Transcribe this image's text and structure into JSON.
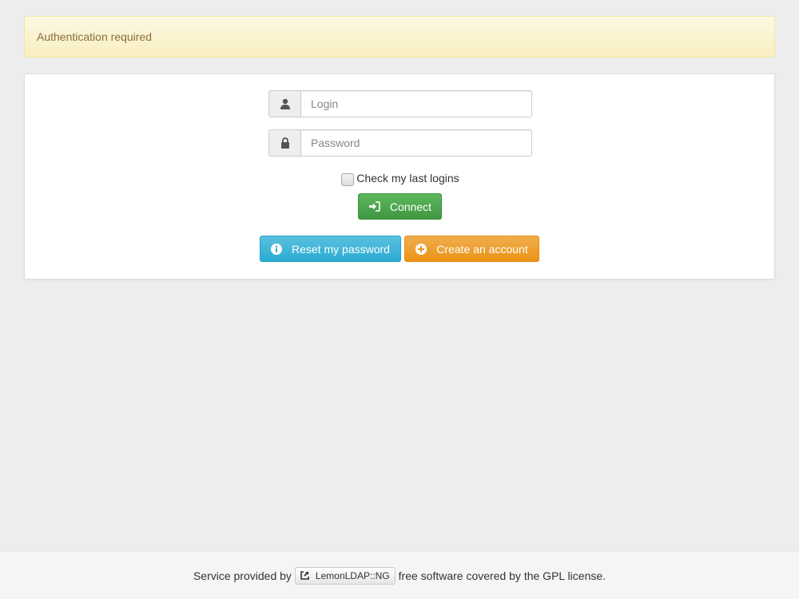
{
  "alert": {
    "text": "Authentication required"
  },
  "form": {
    "login": {
      "placeholder": "Login",
      "value": "",
      "icon": "user-icon"
    },
    "password": {
      "placeholder": "Password",
      "value": "",
      "icon": "lock-icon"
    },
    "remember": {
      "label": "Check my last logins",
      "checked": false
    },
    "connect_label": "Connect",
    "reset_label": "Reset my password",
    "create_label": "Create an account"
  },
  "footer": {
    "prefix": "Service provided by",
    "link_label": "LemonLDAP::NG",
    "suffix": "free software covered by the GPL license."
  },
  "colors": {
    "success": "#5cb85c",
    "info": "#5bc0de",
    "warning": "#f0ad4e",
    "alert_bg": "#fcf8e3"
  }
}
